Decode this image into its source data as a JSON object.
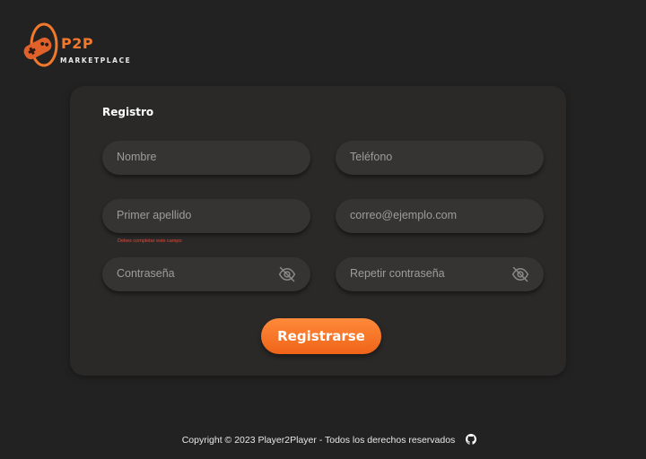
{
  "brand": {
    "name": "P2P",
    "tagline": "MARKETPLACE",
    "accent": "#f2782c"
  },
  "form": {
    "title": "Registro",
    "fields": {
      "nombre": {
        "placeholder": "Nombre"
      },
      "telefono": {
        "placeholder": "Teléfono"
      },
      "apellido": {
        "placeholder": "Primer apellido",
        "error": "Debes completar este campo"
      },
      "correo": {
        "placeholder": "correo@ejemplo.com"
      },
      "password": {
        "placeholder": "Contraseña",
        "icon": "eye-slash-icon"
      },
      "repeat_password": {
        "placeholder": "Repetir contraseña",
        "icon": "eye-slash-icon"
      }
    },
    "submit_label": "Registrarse"
  },
  "footer": {
    "copyright": "Copyright © 2023 Player2Player - Todos los derechos reservados",
    "icon": "github-icon"
  },
  "colors": {
    "background": "#232222",
    "card": "#2a2928",
    "field": "#353433",
    "error": "#e2493a"
  }
}
